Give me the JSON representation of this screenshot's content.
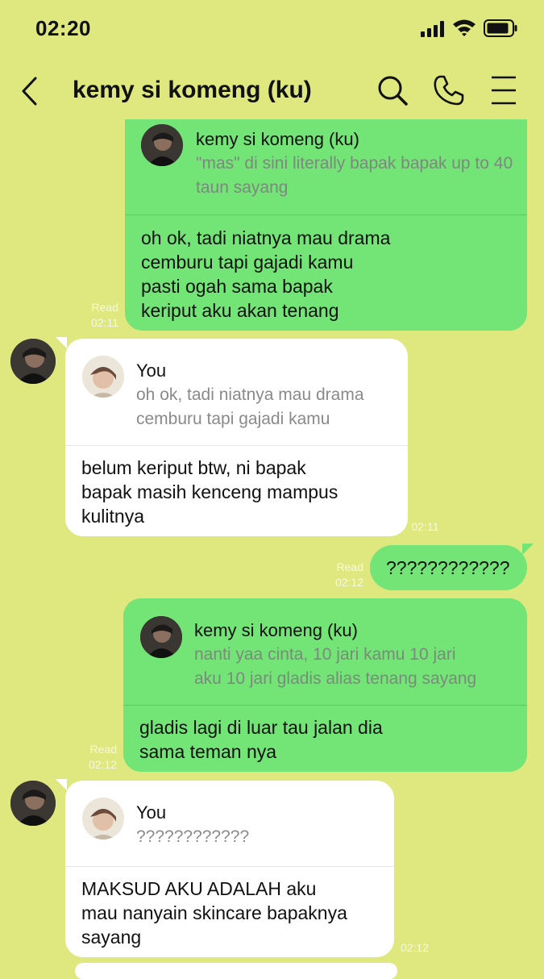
{
  "status_bar": {
    "time": "02:20"
  },
  "header": {
    "title": "kemy si komeng (ku)"
  },
  "messages": [
    {
      "direction": "out",
      "reply_to": {
        "name": "kemy si komeng (ku)",
        "text": "\"mas\" di sini literally bapak bapak up to 40 taun sayang"
      },
      "text_lines": [
        "oh ok, tadi niatnya mau drama",
        "cemburu tapi gajadi kamu",
        "pasti ogah sama bapak",
        "keriput aku akan tenang"
      ],
      "read": "Read",
      "time": "02:11"
    },
    {
      "direction": "in",
      "reply_to": {
        "name": "You",
        "text_lines": [
          "oh ok, tadi niatnya mau drama",
          "cemburu tapi gajadi kamu"
        ]
      },
      "text_lines": [
        "belum keriput btw, ni bapak",
        "bapak masih kenceng mampus",
        "kulitnya"
      ],
      "time": "02:11"
    },
    {
      "direction": "out",
      "text": "????????????",
      "read": "Read",
      "time": "02:12"
    },
    {
      "direction": "out",
      "reply_to": {
        "name": "kemy si komeng (ku)",
        "text_lines": [
          "nanti yaa cinta, 10 jari kamu 10 jari",
          "aku 10 jari gladis alias tenang sayang"
        ]
      },
      "text_lines": [
        "gladis lagi di luar tau jalan dia",
        "sama teman nya"
      ],
      "read": "Read",
      "time": "02:12"
    },
    {
      "direction": "in",
      "reply_to": {
        "name": "You",
        "text": "????????????"
      },
      "text_lines": [
        "MAKSUD AKU ADALAH aku",
        "mau nanyain skincare bapaknya",
        "sayang"
      ],
      "time": "02:12"
    }
  ],
  "icons": {
    "back": "chevron-left-icon",
    "search": "search-icon",
    "call": "phone-icon",
    "menu": "menu-icon"
  },
  "colors": {
    "background": "#dfe87e",
    "outgoing_bubble": "#73e476",
    "incoming_bubble": "#ffffff"
  }
}
